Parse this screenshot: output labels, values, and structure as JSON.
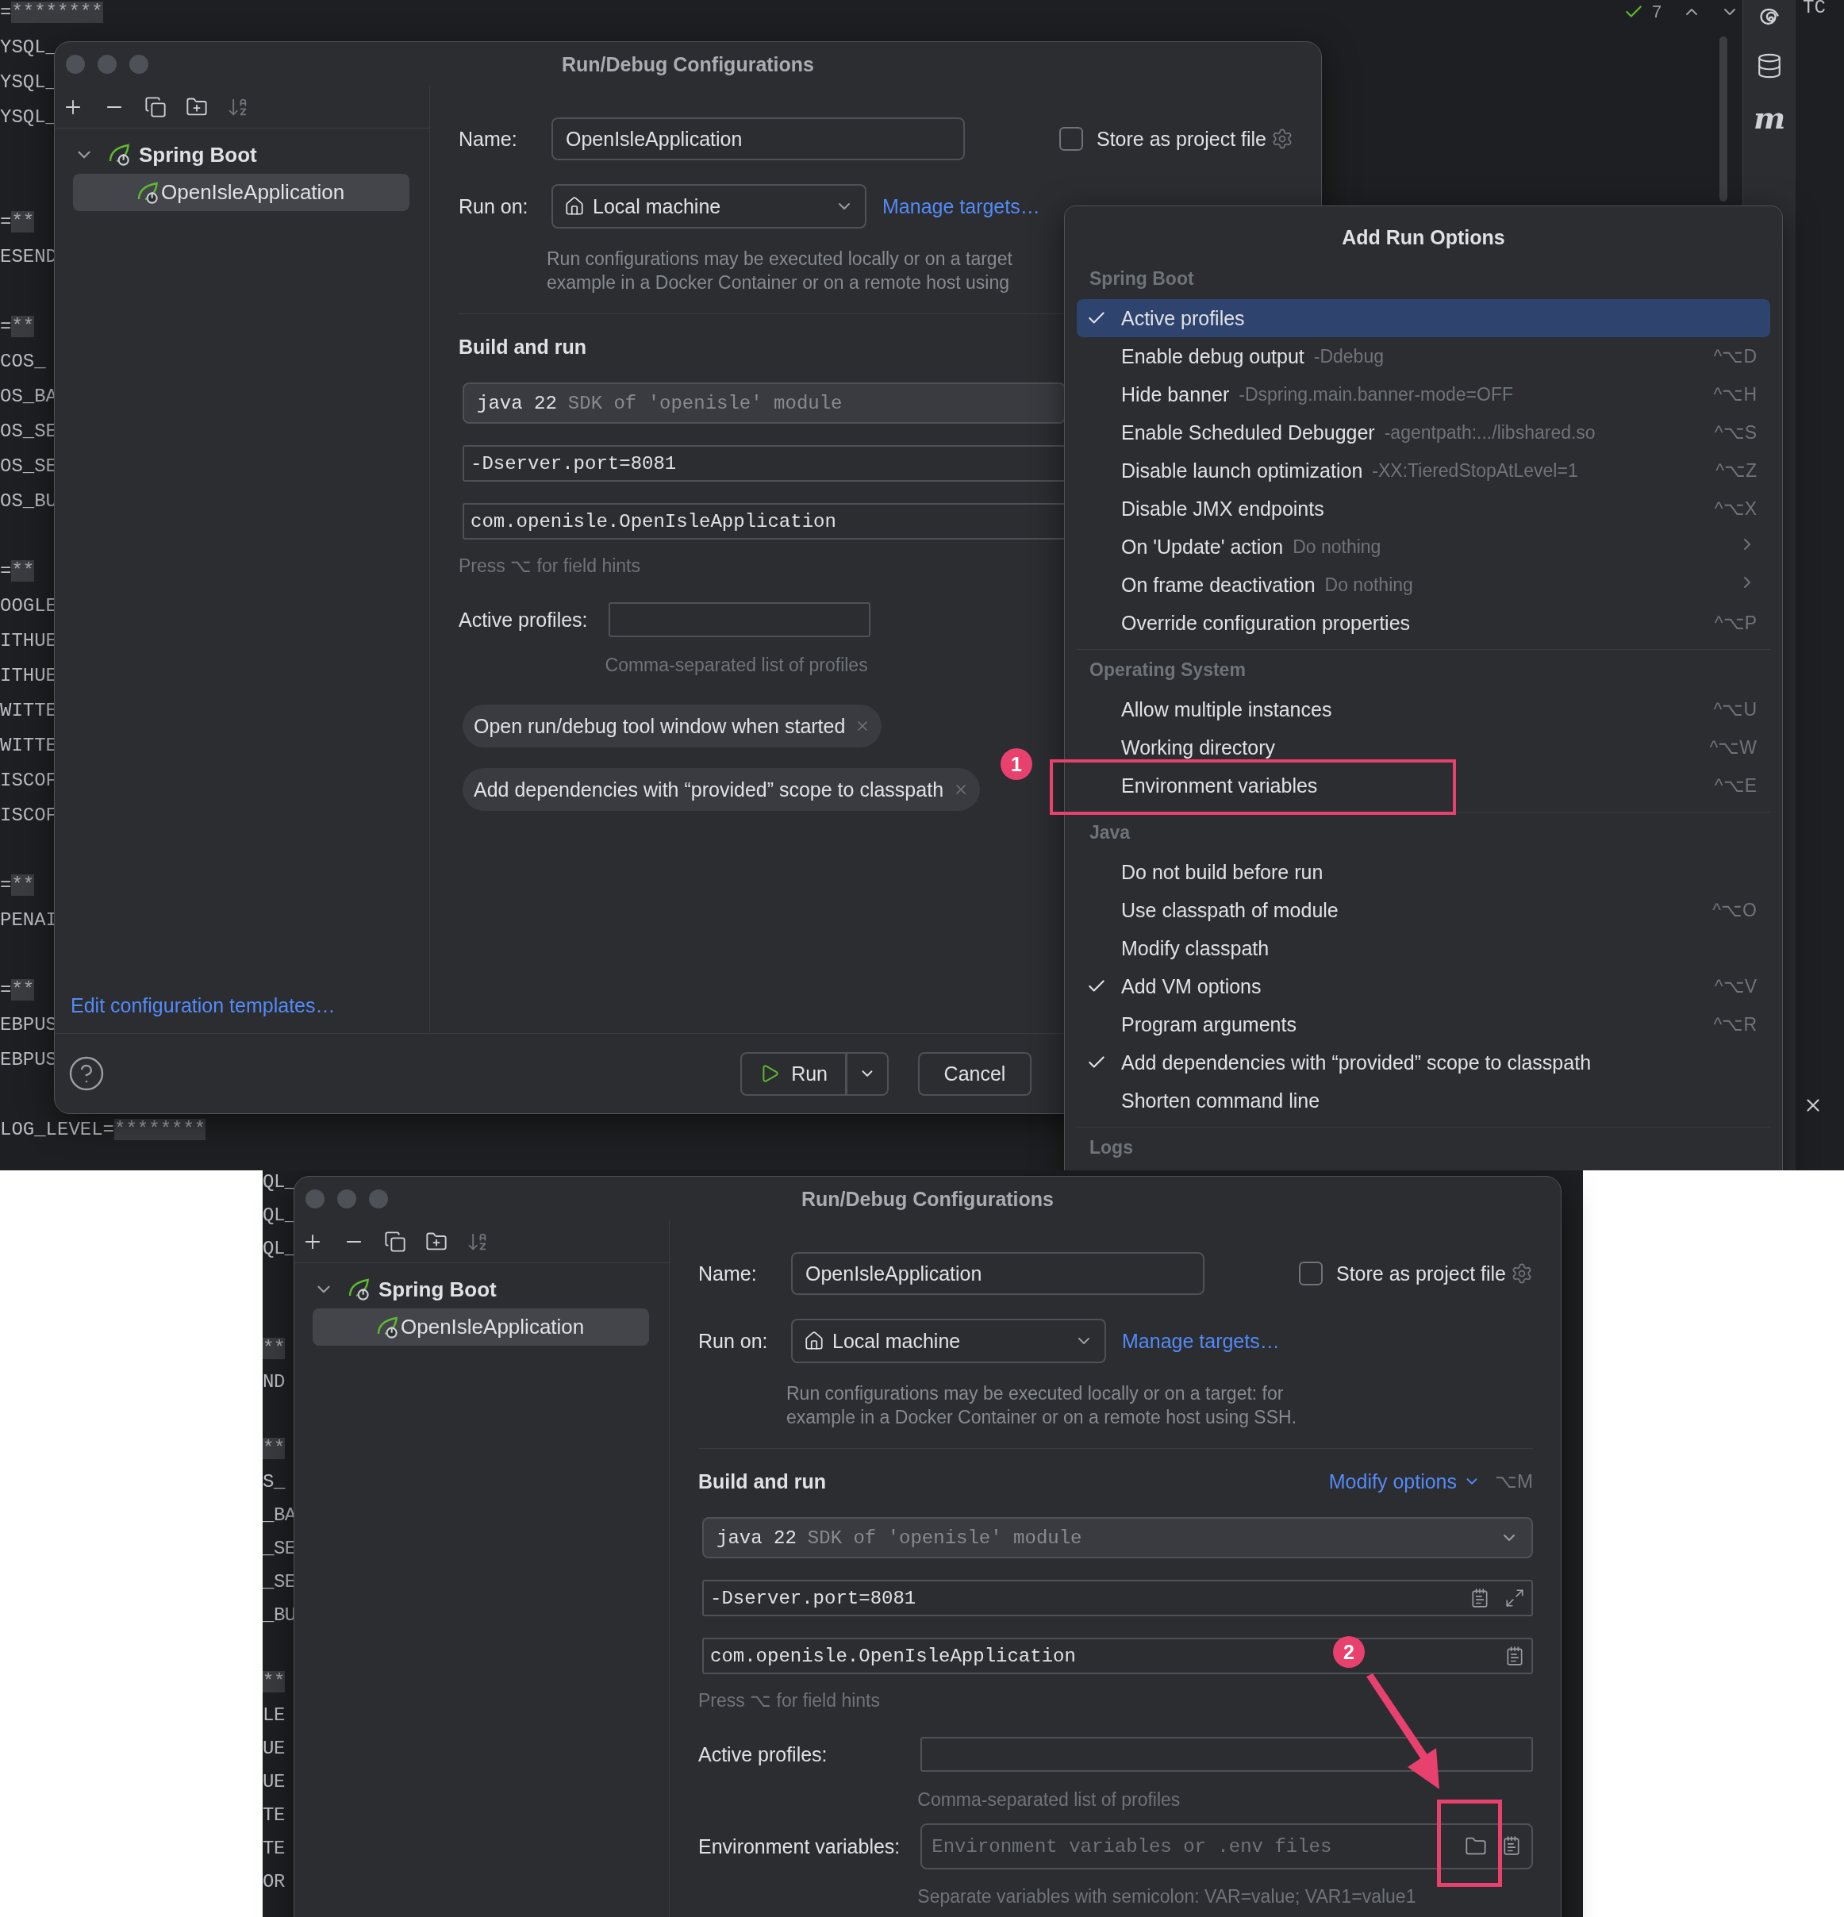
{
  "top_editor": {
    "code_blocks": [
      [
        {
          "text": "=",
          "masked": "********"
        },
        {
          "text": "YSQL_"
        },
        {
          "text": "YSQL_"
        },
        {
          "text": "YSQL_"
        }
      ],
      [
        {
          "text": "=",
          "masked": "**"
        },
        {
          "text": "ESEND"
        }
      ],
      [
        {
          "text": "=",
          "masked": "**"
        },
        {
          "text": "COS_"
        },
        {
          "text": "OS_BA"
        },
        {
          "text": "OS_SE"
        },
        {
          "text": "OS_SE"
        },
        {
          "text": "OS_BU"
        }
      ],
      [
        {
          "text": "=",
          "masked": "**"
        },
        {
          "text": "OOGLE"
        },
        {
          "text": "ITHUE"
        },
        {
          "text": "ITHUE"
        },
        {
          "text": "WITTE"
        },
        {
          "text": "WITTE"
        },
        {
          "text": "ISCOF"
        },
        {
          "text": "ISCOF"
        }
      ],
      [
        {
          "text": "=",
          "masked": "**"
        },
        {
          "text": "PENAI"
        }
      ],
      [
        {
          "text": "=",
          "masked": "**"
        },
        {
          "text": "EBPUS"
        },
        {
          "text": "EBPUS"
        }
      ],
      [
        {
          "text": "LOG_LEVEL=",
          "masked": "********"
        }
      ]
    ],
    "problems_count": "7",
    "tool_label": "m",
    "edge_text": "TC"
  },
  "top_dialog": {
    "title": "Run/Debug Configurations",
    "tree": {
      "label": "Spring Boot",
      "expanded": true,
      "children": [
        {
          "label": "OpenIsleApplication",
          "selected": true
        }
      ]
    },
    "name_label": "Name:",
    "name_value": "OpenIsleApplication",
    "store_label": "Store as project file",
    "store_checked": false,
    "run_on_label": "Run on:",
    "run_on_value": "Local machine",
    "manage_targets": "Manage targets…",
    "description": [
      "Run configurations may be executed locally or on a target",
      "example in a Docker Container or on a remote host using"
    ],
    "section_title": "Build and run",
    "fields": [
      {
        "kind": "sdk",
        "value": "java 22",
        "hint": "SDK of 'openisle' module"
      },
      {
        "kind": "vm_options",
        "value": "-Dserver.port=8081"
      },
      {
        "kind": "main_class",
        "value": "com.openisle.OpenIsleApplication"
      }
    ],
    "field_hint": "Press ⌥ for field hints",
    "options": [
      {
        "kind": "profiles",
        "label": "Active profiles:",
        "hint": "Comma-separated list of profiles"
      }
    ],
    "tags": [
      {
        "label": "Open run/debug tool window when started"
      },
      {
        "label": "Add dependencies with “provided” scope to classpath"
      }
    ],
    "templates_link": "Edit configuration templates…",
    "footer": {
      "run": "Run",
      "cancel": "Cancel"
    }
  },
  "menu": {
    "title": "Add Run Options",
    "sections": [
      {
        "title": "Spring Boot",
        "items": [
          {
            "label": "Active profiles",
            "checked": true,
            "selected": true
          },
          {
            "label": "Enable debug output",
            "hint": "-Ddebug",
            "shortcut": "^⌥D",
            "checked": false,
            "selected": false
          },
          {
            "label": "Hide banner",
            "hint": "-Dspring.main.banner-mode=OFF",
            "shortcut": "^⌥H",
            "checked": false,
            "selected": false
          },
          {
            "label": "Enable Scheduled Debugger",
            "hint": "-agentpath:.../libshared.so",
            "shortcut": "^⌥S",
            "checked": false,
            "selected": false
          },
          {
            "label": "Disable launch optimization",
            "hint": "-XX:TieredStopAtLevel=1",
            "shortcut": "^⌥Z",
            "checked": false,
            "selected": false
          },
          {
            "label": "Disable JMX endpoints",
            "shortcut": "^⌥X",
            "checked": false,
            "selected": false
          },
          {
            "label": "On 'Update' action",
            "hint": "Do nothing",
            "submenu": true,
            "checked": false,
            "selected": false
          },
          {
            "label": "On frame deactivation",
            "hint": "Do nothing",
            "submenu": true,
            "checked": false,
            "selected": false
          },
          {
            "label": "Override configuration properties",
            "shortcut": "^⌥P",
            "checked": false,
            "selected": false
          }
        ]
      },
      {
        "title": "Operating System",
        "items": [
          {
            "label": "Allow multiple instances",
            "shortcut": "^⌥U",
            "checked": false,
            "selected": false
          },
          {
            "label": "Working directory",
            "shortcut": "^⌥W",
            "checked": false,
            "selected": false
          },
          {
            "label": "Environment variables",
            "shortcut": "^⌥E",
            "annotated": true,
            "checked": false,
            "selected": false
          }
        ]
      },
      {
        "title": "Java",
        "items": [
          {
            "label": "Do not build before run",
            "checked": false,
            "selected": false
          },
          {
            "label": "Use classpath of module",
            "shortcut": "^⌥O",
            "checked": false,
            "selected": false
          },
          {
            "label": "Modify classpath",
            "checked": false,
            "selected": false
          },
          {
            "label": "Add VM options",
            "shortcut": "^⌥V",
            "checked": true,
            "selected": false
          },
          {
            "label": "Program arguments",
            "shortcut": "^⌥R",
            "checked": false,
            "selected": false
          },
          {
            "label": "Add dependencies with “provided” scope to classpath",
            "checked": true,
            "selected": false
          },
          {
            "label": "Shorten command line",
            "checked": false,
            "selected": false
          }
        ]
      },
      {
        "title": "Logs"
      }
    ]
  },
  "top_annotations": [
    {
      "kind": "badge",
      "text": "1"
    }
  ],
  "bottom_editor": {
    "code_blocks": [
      [
        {
          "text": "QL_"
        },
        {
          "text": "QL_"
        },
        {
          "text": "QL_"
        }
      ],
      [
        {
          "masked": "**"
        },
        {
          "text": "ND"
        }
      ],
      [
        {
          "masked": "**"
        },
        {
          "text": "S_"
        },
        {
          "text": "_BA"
        },
        {
          "text": "_SE"
        },
        {
          "text": "_SE"
        },
        {
          "text": "_BU"
        }
      ],
      [
        {
          "masked": "**"
        },
        {
          "text": "LE"
        },
        {
          "text": "UE"
        },
        {
          "text": "UE"
        },
        {
          "text": "TE"
        },
        {
          "text": "TE"
        },
        {
          "text": "OR"
        }
      ]
    ]
  },
  "bottom_dialog": {
    "title": "Run/Debug Configurations",
    "tree": {
      "label": "Spring Boot",
      "expanded": true,
      "children": [
        {
          "label": "OpenIsleApplication",
          "selected": true
        }
      ]
    },
    "name_label": "Name:",
    "name_value": "OpenIsleApplication",
    "store_label": "Store as project file",
    "store_checked": false,
    "run_on_label": "Run on:",
    "run_on_value": "Local machine",
    "manage_targets": "Manage targets…",
    "description": [
      "Run configurations may be executed locally or on a target: for",
      "example in a Docker Container or on a remote host using SSH."
    ],
    "section_title": "Build and run",
    "modify_options": {
      "label": "Modify options",
      "shortcut": "⌥M"
    },
    "fields": [
      {
        "kind": "sdk",
        "value": "java 22",
        "hint": "SDK of 'openisle' module"
      },
      {
        "kind": "vm_options",
        "value": "-Dserver.port=8081"
      },
      {
        "kind": "main_class",
        "value": "com.openisle.OpenIsleApplication"
      }
    ],
    "field_hint": "Press ⌥ for field hints",
    "options": [
      {
        "kind": "profiles",
        "label": "Active profiles:",
        "hint": "Comma-separated list of profiles"
      },
      {
        "kind": "env",
        "label": "Environment variables:",
        "placeholder": "Environment variables or .env files",
        "hint": "Separate variables with semicolon: VAR=value; VAR1=value1"
      }
    ]
  },
  "bottom_annotations": [
    {
      "kind": "badge",
      "text": "2"
    },
    {
      "kind": "arrow"
    },
    {
      "kind": "frame"
    }
  ]
}
